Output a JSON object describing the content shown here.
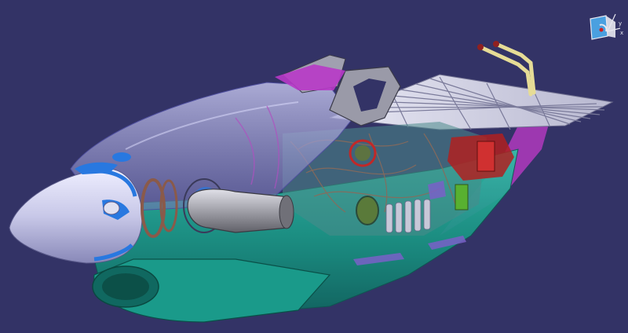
{
  "viewport": {
    "background_color": "#333366",
    "compass_icon": "compass-icon"
  },
  "model": {
    "colors": {
      "nose_cone": "#c8c8e8",
      "fuselage_glass": "#9a9ad0",
      "teal_body": "#1a9a8a",
      "magenta_panel": "#b040c0",
      "blue_highlight": "#2878e0",
      "red_component": "#c82828",
      "grille": "#c8c8d8",
      "exhaust": "#909098",
      "wires": "#8a6a5a",
      "pipe": "#e0d890"
    }
  }
}
